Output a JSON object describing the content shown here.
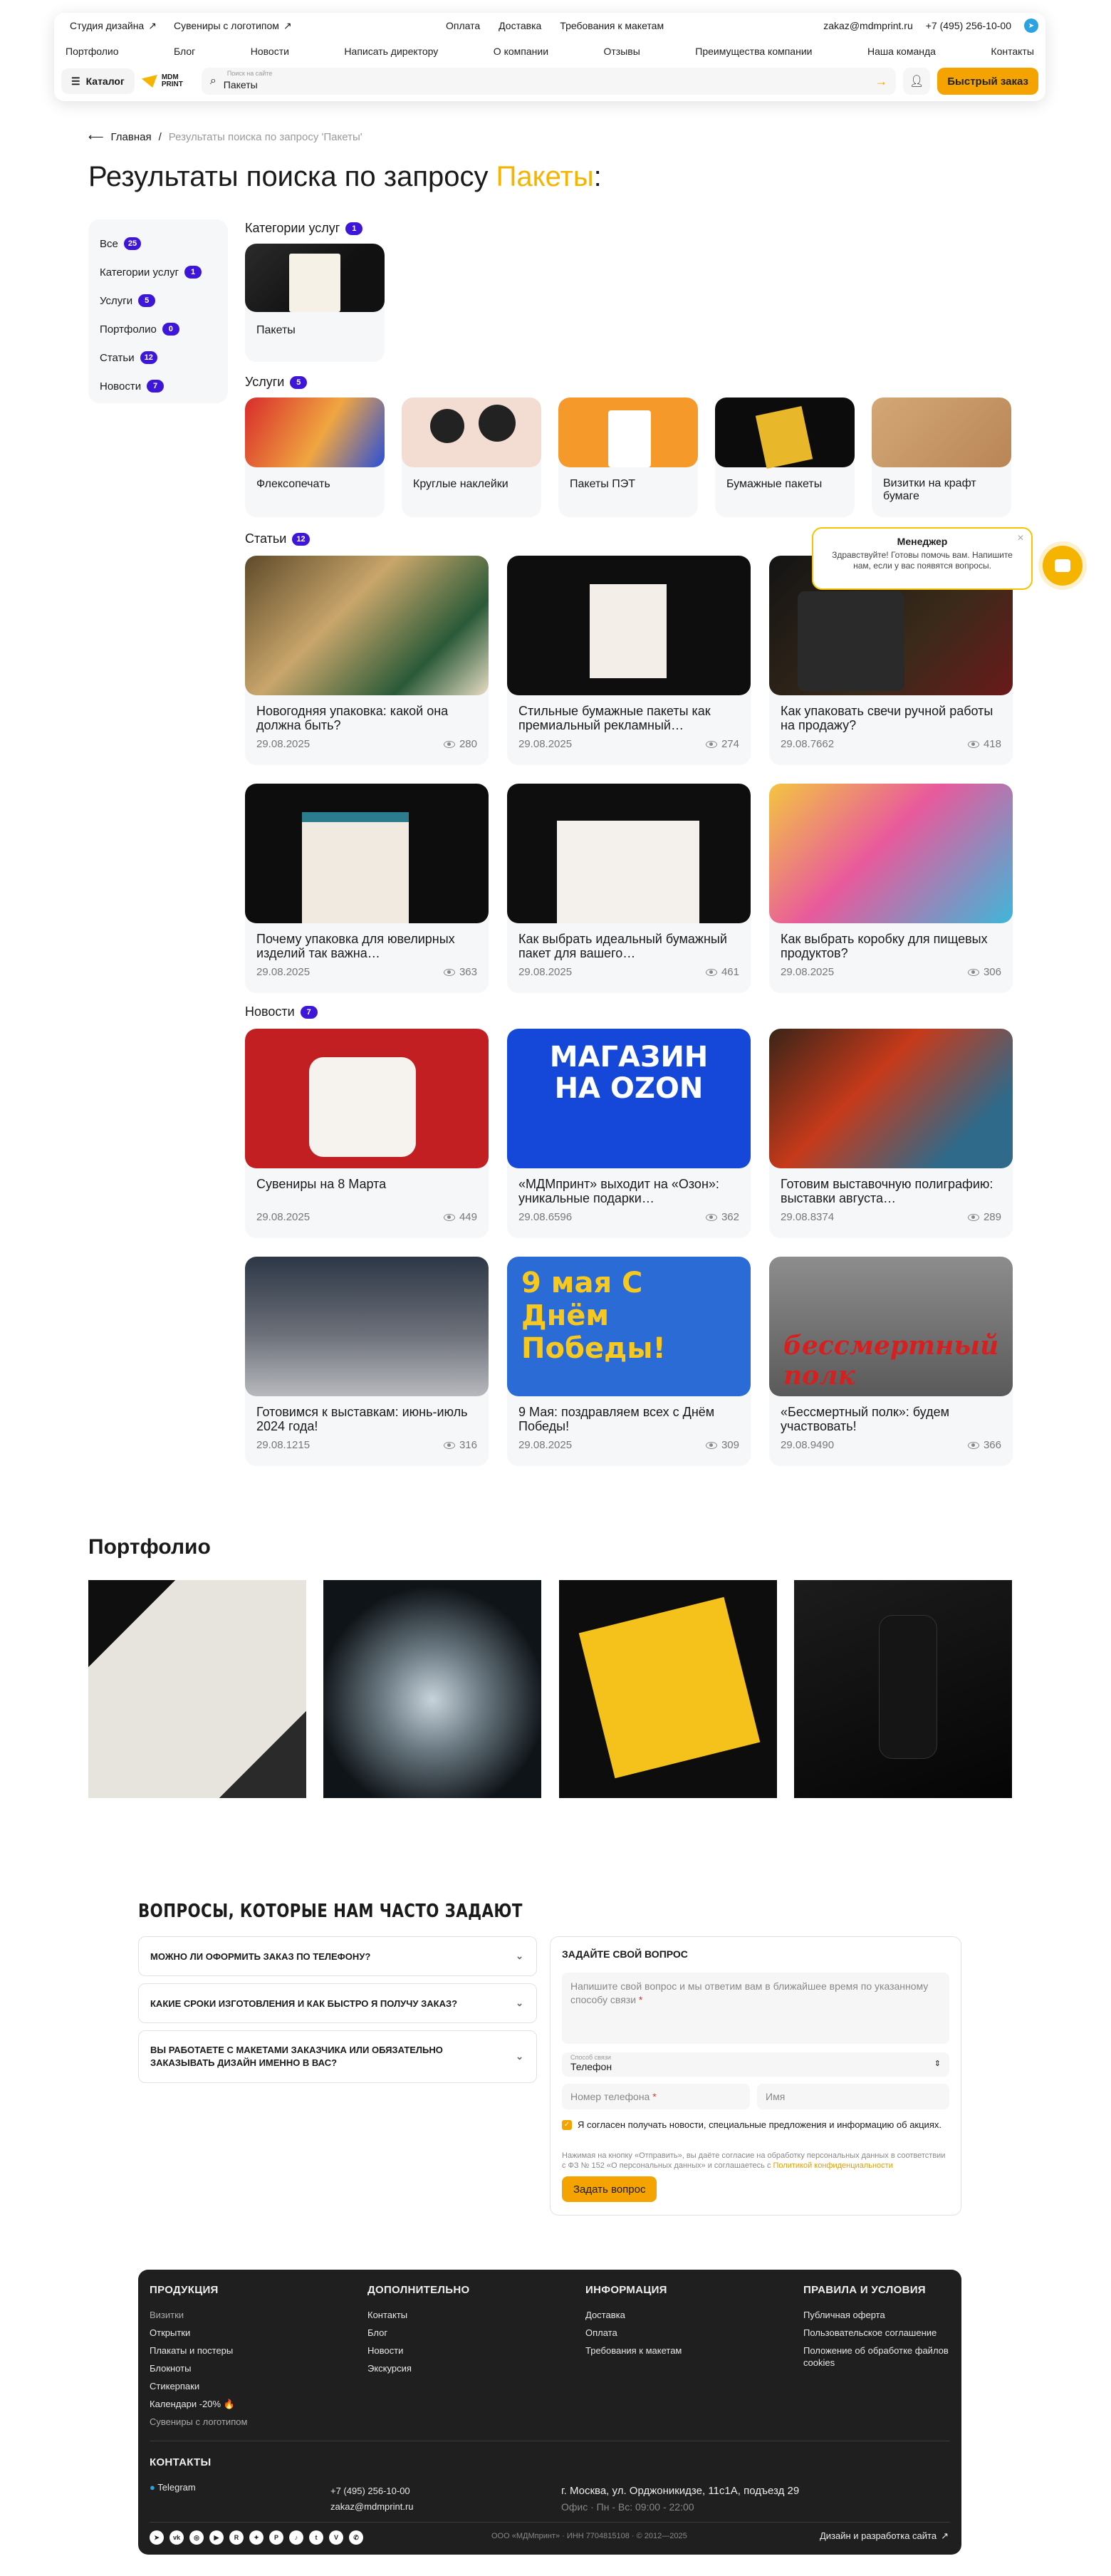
{
  "header": {
    "studio": "Студия дизайна",
    "souvenirs": "Сувениры с логотипом",
    "top_links": [
      "Оплата",
      "Доставка",
      "Требования к макетам"
    ],
    "email": "zakaz@mdmprint.ru",
    "phone": "+7 (495) 256-10-00",
    "nav": [
      "Портфолио",
      "Блог",
      "Новости",
      "Написать директору",
      "О компании",
      "Отзывы",
      "Преимущества компании",
      "Наша команда",
      "Контакты"
    ],
    "catalog": "Каталог",
    "logo": [
      "MDM",
      "PRINT"
    ],
    "search_placeholder": "Поиск на сайте",
    "search_value": "Пакеты",
    "quick_order": "Быстрый заказ"
  },
  "breadcrumb": {
    "home": "Главная",
    "current": "Результаты поиска по запросу 'Пакеты'"
  },
  "title": {
    "prefix": "Результаты поиска по запросу ",
    "query": "Пакеты",
    "suffix": ":"
  },
  "filters": [
    {
      "label": "Все",
      "count": "25"
    },
    {
      "label": "Категории услуг",
      "count": "1"
    },
    {
      "label": "Услуги",
      "count": "5"
    },
    {
      "label": "Портфолио",
      "count": "0"
    },
    {
      "label": "Статьи",
      "count": "12"
    },
    {
      "label": "Новости",
      "count": "7"
    }
  ],
  "categories": {
    "title": "Категории услуг",
    "count": "1",
    "items": [
      {
        "title": "Пакеты"
      }
    ]
  },
  "services": {
    "title": "Услуги",
    "count": "5",
    "items": [
      {
        "title": "Флексопечать"
      },
      {
        "title": "Круглые наклейки"
      },
      {
        "title": "Пакеты ПЭТ"
      },
      {
        "title": "Бумажные пакеты"
      },
      {
        "title": "Визитки на крафт бумаге"
      }
    ]
  },
  "articles": {
    "title": "Статьи",
    "count": "12",
    "items": [
      {
        "title": "Новогодняя упаковка: какой она должна быть?",
        "date": "29.08.2025",
        "views": "280"
      },
      {
        "title": "Стильные бумажные пакеты как премиальный рекламный…",
        "date": "29.08.2025",
        "views": "274"
      },
      {
        "title": "Как упаковать свечи ручной работы на продажу?",
        "date": "29.08.7662",
        "views": "418"
      },
      {
        "title": "Почему упаковка для ювелирных изделий так важна…",
        "date": "29.08.2025",
        "views": "363"
      },
      {
        "title": "Как выбрать идеальный бумажный пакет для вашего…",
        "date": "29.08.2025",
        "views": "461"
      },
      {
        "title": "Как выбрать коробку для пищевых продуктов?",
        "date": "29.08.2025",
        "views": "306"
      }
    ]
  },
  "news": {
    "title": "Новости",
    "count": "7",
    "items": [
      {
        "title": "Сувениры на 8 Марта",
        "date": "29.08.2025",
        "views": "449",
        "img_text": ""
      },
      {
        "title": "«МДМпринт» выходит на «Озон»: уникальные подарки…",
        "date": "29.08.6596",
        "views": "362",
        "img_text": "МАГАЗИН НА OZON"
      },
      {
        "title": "Готовим выставочную полиграфию: выставки августа…",
        "date": "29.08.8374",
        "views": "289",
        "img_text": ""
      },
      {
        "title": "Готовимся к выставкам: июнь-июль 2024 года!",
        "date": "29.08.1215",
        "views": "316",
        "img_text": ""
      },
      {
        "title": "9 Мая: поздравляем всех с Днём Победы!",
        "date": "29.08.2025",
        "views": "309",
        "img_text": "9 мая С Днём Победы!"
      },
      {
        "title": "«Бессмертный полк»: будем участвовать!",
        "date": "29.08.9490",
        "views": "366",
        "img_text": "бессмертный полк"
      }
    ]
  },
  "chat": {
    "name": "Менеджер",
    "message": "Здравствуйте! Готовы помочь вам. Напишите нам, если у вас появятся вопросы."
  },
  "portfolio": {
    "title": "Портфолио"
  },
  "faq": {
    "title": "ВОПРОСЫ, КОТОРЫЕ НАМ ЧАСТО ЗАДАЮТ",
    "questions": [
      "МОЖНО ЛИ ОФОРМИТЬ ЗАКАЗ ПО ТЕЛЕФОНУ?",
      "КАКИЕ СРОКИ ИЗГОТОВЛЕНИЯ И КАК БЫСТРО Я ПОЛУЧУ ЗАКАЗ?",
      "ВЫ РАБОТАЕТЕ С МАКЕТАМИ ЗАКАЗЧИКА ИЛИ ОБЯЗАТЕЛЬНО ЗАКАЗЫВАТЬ ДИЗАЙН ИМЕННО В ВАС?"
    ]
  },
  "form": {
    "title": "ЗАДАЙТЕ СВОЙ ВОПРОС",
    "textarea": "Напишите свой вопрос и мы ответим вам в ближайшее время по указанному способу связи",
    "method_label": "Способ связи",
    "method_value": "Телефон",
    "phone": "Номер телефона",
    "name": "Имя",
    "consent": "Я согласен получать новости, специальные предложения и информацию об акциях.",
    "legal": "Нажимая на кнопку «Отправить», вы даёте согласие на обработку персональных данных в соответствии с ФЗ № 152 «О персональных данных» и соглашаетесь с ",
    "legal_link": "Политикой конфиденциальности",
    "submit": "Задать вопрос"
  },
  "footer": {
    "products_title": "ПРОДУКЦИЯ",
    "products": [
      "Визитки",
      "Открытки",
      "Плакаты и постеры",
      "Блокноты",
      "Стикерпаки",
      "Календари -20% 🔥",
      "Сувениры с логотипом"
    ],
    "extra_title": "ДОПОЛНИТЕЛЬНО",
    "extra": [
      "Контакты",
      "Блог",
      "Новости",
      "Экскурсия"
    ],
    "info_title": "ИНФОРМАЦИЯ",
    "info": [
      "Доставка",
      "Оплата",
      "Требования к макетам"
    ],
    "rules_title": "ПРАВИЛА И УСЛОВИЯ",
    "rules": [
      "Публичная оферта",
      "Пользовательское соглашение",
      "Положение об обработке файлов cookies"
    ],
    "contacts_title": "КОНТАКТЫ",
    "telegram": "Telegram",
    "phone": "+7 (495) 256-10-00",
    "email": "zakaz@mdmprint.ru",
    "address": "г. Москва, ул. Орджоникидзе, 11с1А, подъезд 29",
    "hours": "Офис · Пн - Вс: 09:00 - 22:00",
    "legal": "ООО «МДМпринт» · ИНН 7704815108 · © 2012—2025",
    "dev": "Дизайн и разработка сайта"
  }
}
